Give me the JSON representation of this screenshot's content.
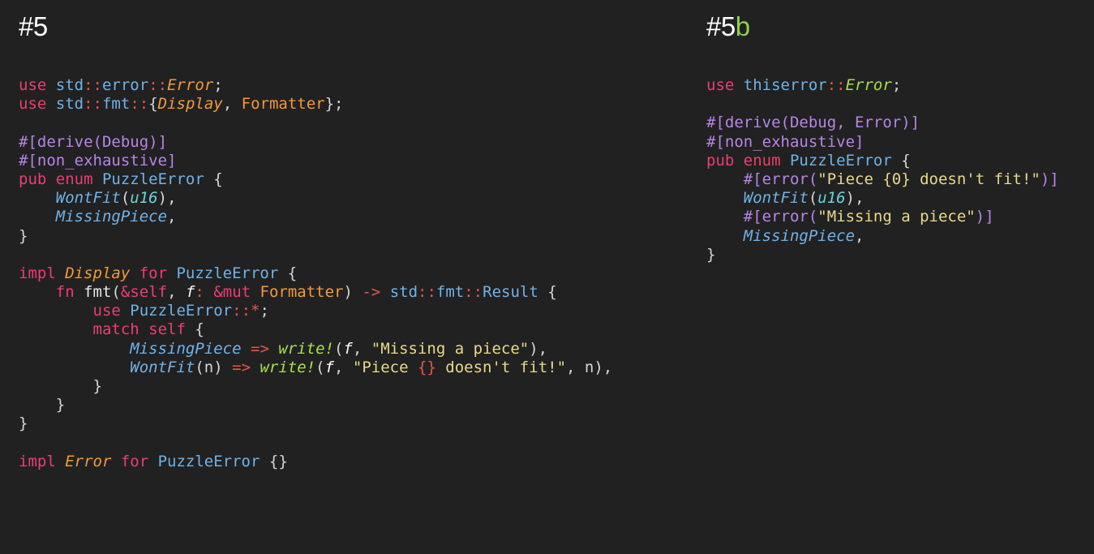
{
  "left": {
    "heading": "#5",
    "lines": [
      [
        [
          "kw",
          "use "
        ],
        [
          "path",
          "std"
        ],
        [
          "op",
          "::"
        ],
        [
          "path",
          "error"
        ],
        [
          "op",
          "::"
        ],
        [
          "trait",
          "Error"
        ],
        [
          "punct",
          ";"
        ]
      ],
      [
        [
          "kw",
          "use "
        ],
        [
          "path",
          "std"
        ],
        [
          "op",
          "::"
        ],
        [
          "path",
          "fmt"
        ],
        [
          "op",
          "::"
        ],
        [
          "punct",
          "{"
        ],
        [
          "trait",
          "Display"
        ],
        [
          "punct",
          ", "
        ],
        [
          "typ",
          "Formatter"
        ],
        [
          "punct",
          "};"
        ]
      ],
      [],
      [
        [
          "attr",
          "#[derive(Debug)]"
        ]
      ],
      [
        [
          "attr",
          "#[non_exhaustive]"
        ]
      ],
      [
        [
          "kw",
          "pub enum "
        ],
        [
          "enum-name",
          "PuzzleError"
        ],
        [
          "punct",
          " {"
        ]
      ],
      [
        [
          "plain",
          "    "
        ],
        [
          "variant",
          "WontFit"
        ],
        [
          "punct",
          "("
        ],
        [
          "prim",
          "u16"
        ],
        [
          "punct",
          "),"
        ]
      ],
      [
        [
          "plain",
          "    "
        ],
        [
          "variant",
          "MissingPiece"
        ],
        [
          "punct",
          ","
        ]
      ],
      [
        [
          "punct",
          "}"
        ]
      ],
      [],
      [
        [
          "kw",
          "impl "
        ],
        [
          "trait",
          "Display"
        ],
        [
          "kw",
          " for "
        ],
        [
          "enum-name",
          "PuzzleError"
        ],
        [
          "punct",
          " {"
        ]
      ],
      [
        [
          "plain",
          "    "
        ],
        [
          "kw",
          "fn "
        ],
        [
          "fn-name",
          "fmt"
        ],
        [
          "punct",
          "("
        ],
        [
          "kw",
          "&self"
        ],
        [
          "punct",
          ", "
        ],
        [
          "param",
          "f"
        ],
        [
          "op",
          ": "
        ],
        [
          "kw",
          "&mut "
        ],
        [
          "typ",
          "Formatter"
        ],
        [
          "punct",
          ") "
        ],
        [
          "op",
          "-> "
        ],
        [
          "path",
          "std"
        ],
        [
          "op",
          "::"
        ],
        [
          "path",
          "fmt"
        ],
        [
          "op",
          "::"
        ],
        [
          "enum-name",
          "Result"
        ],
        [
          "punct",
          " {"
        ]
      ],
      [
        [
          "plain",
          "        "
        ],
        [
          "kw",
          "use "
        ],
        [
          "enum-name",
          "PuzzleError"
        ],
        [
          "op",
          "::*"
        ],
        [
          "punct",
          ";"
        ]
      ],
      [
        [
          "plain",
          "        "
        ],
        [
          "kw",
          "match self "
        ],
        [
          "punct",
          "{"
        ]
      ],
      [
        [
          "plain",
          "            "
        ],
        [
          "variant",
          "MissingPiece"
        ],
        [
          "op",
          " => "
        ],
        [
          "macro",
          "write!"
        ],
        [
          "punct",
          "("
        ],
        [
          "param",
          "f"
        ],
        [
          "punct",
          ", "
        ],
        [
          "str",
          "\"Missing a piece\""
        ],
        [
          "punct",
          "),"
        ]
      ],
      [
        [
          "plain",
          "            "
        ],
        [
          "variant",
          "WontFit"
        ],
        [
          "punct",
          "(n)"
        ],
        [
          "op",
          " => "
        ],
        [
          "macro",
          "write!"
        ],
        [
          "punct",
          "("
        ],
        [
          "param",
          "f"
        ],
        [
          "punct",
          ", "
        ],
        [
          "str",
          "\"Piece "
        ],
        [
          "fmt",
          "{}"
        ],
        [
          "str",
          " doesn't fit!\""
        ],
        [
          "punct",
          ", n),"
        ]
      ],
      [
        [
          "plain",
          "        "
        ],
        [
          "punct",
          "}"
        ]
      ],
      [
        [
          "plain",
          "    "
        ],
        [
          "punct",
          "}"
        ]
      ],
      [
        [
          "punct",
          "}"
        ]
      ],
      [],
      [
        [
          "kw",
          "impl "
        ],
        [
          "trait",
          "Error"
        ],
        [
          "kw",
          " for "
        ],
        [
          "enum-name",
          "PuzzleError"
        ],
        [
          "punct",
          " {}"
        ]
      ]
    ]
  },
  "right": {
    "heading": "#5",
    "heading_suffix": "b",
    "lines": [
      [
        [
          "kw",
          "use "
        ],
        [
          "path",
          "thiserror"
        ],
        [
          "op",
          "::"
        ],
        [
          "trait-green",
          "Error"
        ],
        [
          "punct",
          ";"
        ]
      ],
      [],
      [
        [
          "attr",
          "#[derive(Debug, Error)]"
        ]
      ],
      [
        [
          "attr",
          "#[non_exhaustive]"
        ]
      ],
      [
        [
          "kw",
          "pub enum "
        ],
        [
          "enum-name",
          "PuzzleError"
        ],
        [
          "punct",
          " {"
        ]
      ],
      [
        [
          "plain",
          "    "
        ],
        [
          "attr",
          "#[error("
        ],
        [
          "str",
          "\"Piece {0} doesn't fit!\""
        ],
        [
          "attr",
          ")]"
        ]
      ],
      [
        [
          "plain",
          "    "
        ],
        [
          "variant",
          "WontFit"
        ],
        [
          "punct",
          "("
        ],
        [
          "prim",
          "u16"
        ],
        [
          "punct",
          "),"
        ]
      ],
      [
        [
          "plain",
          "    "
        ],
        [
          "attr",
          "#[error("
        ],
        [
          "str",
          "\"Missing a piece\""
        ],
        [
          "attr",
          ")]"
        ]
      ],
      [
        [
          "plain",
          "    "
        ],
        [
          "variant",
          "MissingPiece"
        ],
        [
          "punct",
          ","
        ]
      ],
      [
        [
          "punct",
          "}"
        ]
      ]
    ]
  }
}
